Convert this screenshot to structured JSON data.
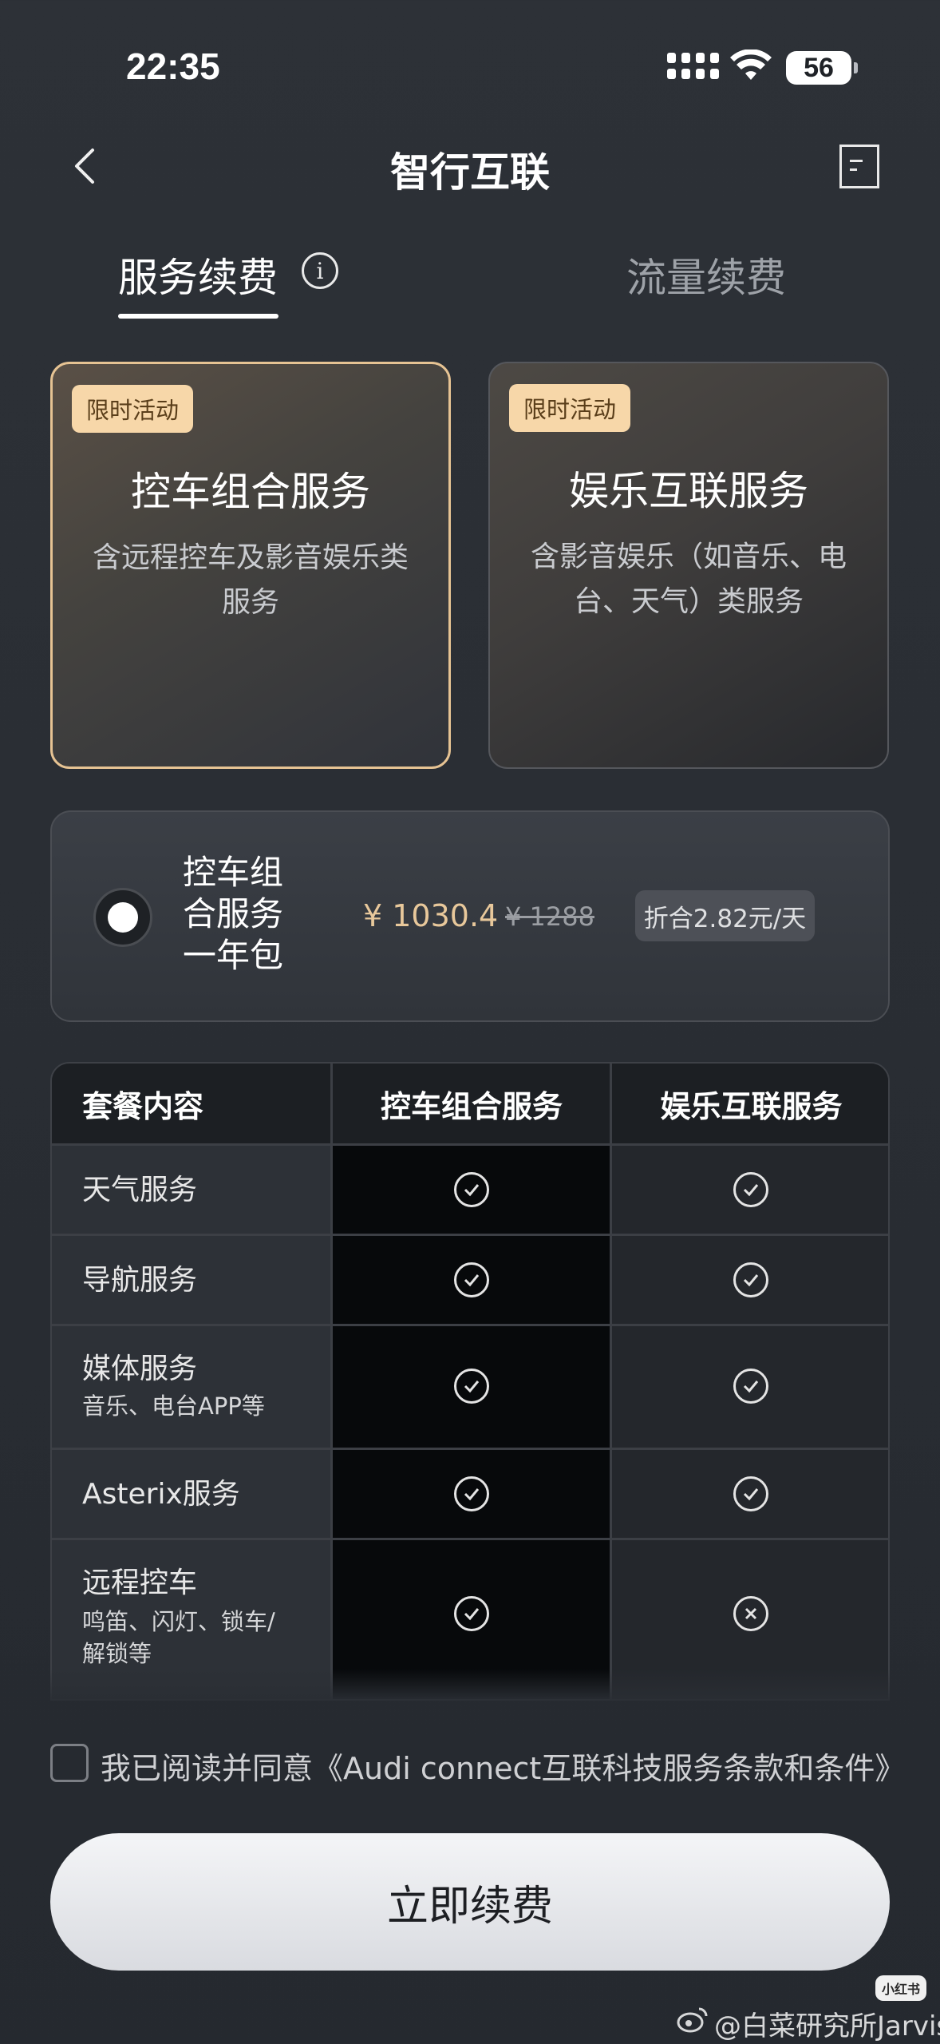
{
  "status_bar": {
    "time": "22:35",
    "battery": "56"
  },
  "nav": {
    "title": "智行互联"
  },
  "tabs": [
    {
      "label": "服务续费",
      "active": true
    },
    {
      "label": "流量续费",
      "active": false
    }
  ],
  "cards": [
    {
      "badge": "限时活动",
      "title": "控车组合服务",
      "desc": "含远程控车及影音娱乐类服务",
      "selected": true
    },
    {
      "badge": "限时活动",
      "title": "娱乐互联服务",
      "desc": "含影音娱乐（如音乐、电台、天气）类服务",
      "selected": false
    }
  ],
  "package": {
    "name": "控车组合服务一年包",
    "price": "¥ 1030.4",
    "original_price": "¥ 1288",
    "per_day": "折合2.82元/天"
  },
  "table": {
    "headers": [
      "套餐内容",
      "控车组合服务",
      "娱乐互联服务"
    ],
    "rows": [
      {
        "label": "天气服务",
        "sub": "",
        "control": "included",
        "entertainment": "included"
      },
      {
        "label": "导航服务",
        "sub": "",
        "control": "included",
        "entertainment": "included"
      },
      {
        "label": "媒体服务",
        "sub": "音乐、电台APP等",
        "control": "included",
        "entertainment": "included"
      },
      {
        "label": "Asterix服务",
        "sub": "",
        "control": "included",
        "entertainment": "included"
      },
      {
        "label": "远程控车",
        "sub": "鸣笛、闪灯、锁车/解锁等",
        "control": "included",
        "entertainment": "excluded"
      }
    ]
  },
  "agreement": {
    "text": "我已阅读并同意《Audi connect互联科技服务条款和条件》"
  },
  "cta": {
    "label": "立即续费"
  },
  "watermark": {
    "logo": "小红书",
    "text": "@白菜研究所Jarvis"
  },
  "colors": {
    "accent_gold": "#e6c393",
    "badge_bg": "#f7d7a9",
    "price": "#e8c89b"
  }
}
